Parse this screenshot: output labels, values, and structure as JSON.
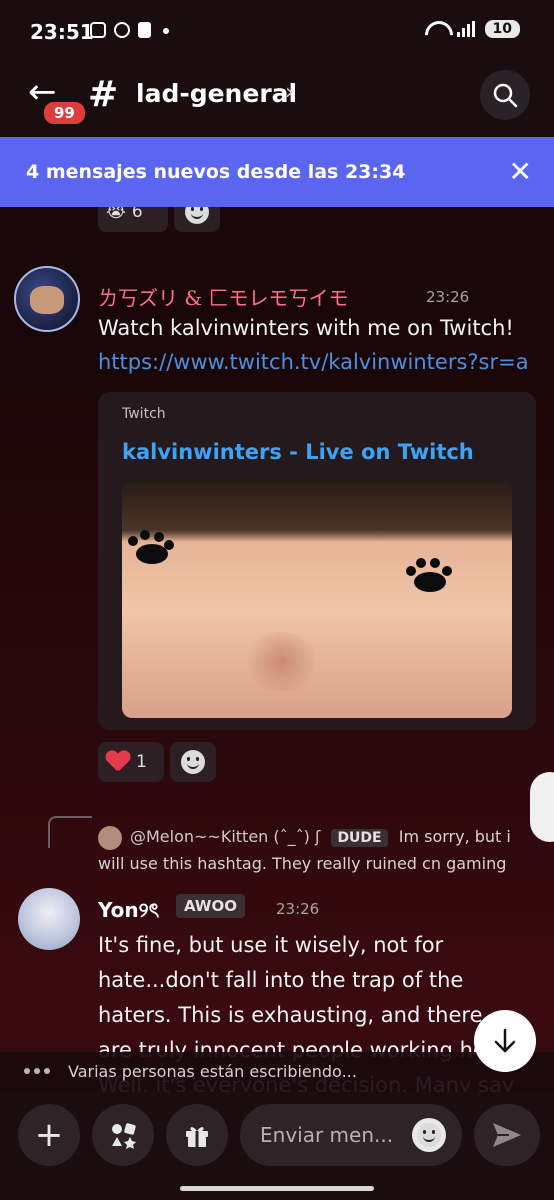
{
  "status_bar": {
    "time": "23:51",
    "battery": "10"
  },
  "header": {
    "unread_badge": "99",
    "channel_name": "lad-general"
  },
  "banner": {
    "text": "4 mensajes nuevos desde las 23:34"
  },
  "prev_reactions": [
    {
      "emoji": "😭",
      "count": "6"
    }
  ],
  "message1": {
    "username": "ㄌ丂ズリ & 匚モレモ丂イモ",
    "timestamp": "23:26",
    "text": "Watch kalvinwinters with me on Twitch!",
    "link": "https://www.twitch.tv/kalvinwinters?sr=a",
    "embed": {
      "provider": "Twitch",
      "title": "kalvinwinters - Live on Twitch"
    },
    "reactions": [
      {
        "emoji": "heart",
        "count": "1"
      }
    ]
  },
  "reply": {
    "username": "@Melon~~Kitten (ˆ_ˆ) ʃ",
    "tag": "DUDE",
    "text_line1": "Im sorry, but i",
    "text_line2": "will use this hashtag. They really ruined cn gaming"
  },
  "message2": {
    "username": "Yon୨ৎ",
    "tag": "AWOO",
    "timestamp": "23:26",
    "text": "It's fine, but use it wisely, not for hate...don't fall into the trap of the haters. This is exhausting, and there are truly innocent people working here. Well, it's everyone's decision. Many say"
  },
  "typing": {
    "text": "Varias personas están escribiendo..."
  },
  "composer": {
    "placeholder": "Enviar men..."
  },
  "colors": {
    "accent": "#5b66f0",
    "link": "#4a90e2",
    "username1": "#ff6f8a",
    "embed_title": "#3fa3f5"
  },
  "icons": [
    "back-arrow-icon",
    "hash-icon",
    "search-icon",
    "close-icon",
    "smile-icon",
    "heart-icon",
    "arrow-down-icon",
    "plus-icon",
    "apps-icon",
    "gift-icon",
    "send-icon"
  ]
}
